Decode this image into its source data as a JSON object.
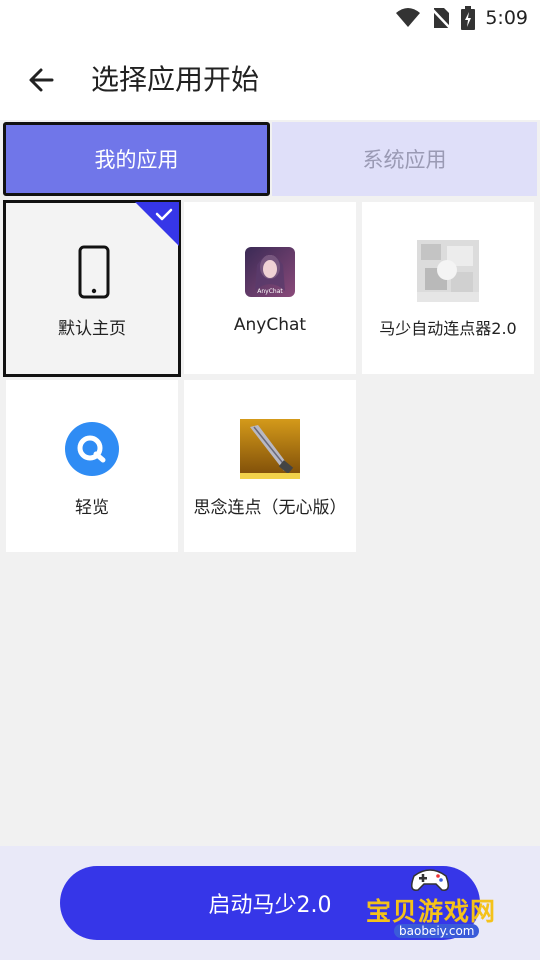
{
  "status": {
    "time": "5:09",
    "icons": [
      "wifi-icon",
      "no-sim-icon",
      "battery-icon"
    ]
  },
  "header": {
    "title": "选择应用开始",
    "back_icon": "arrow-left-icon"
  },
  "tabs": [
    {
      "label": "我的应用",
      "active": true
    },
    {
      "label": "系统应用",
      "active": false
    }
  ],
  "apps": [
    {
      "label": "默认主页",
      "icon": "phone-icon",
      "selected": true
    },
    {
      "label": "AnyChat",
      "icon": "anychat-app-icon",
      "selected": false
    },
    {
      "label": "马少自动连点器2.0",
      "icon": "masha-app-icon",
      "selected": false
    },
    {
      "label": "轻览",
      "icon": "qinglan-app-icon",
      "selected": false
    },
    {
      "label": "思念连点（无心版）",
      "icon": "sinian-app-icon",
      "selected": false
    }
  ],
  "bottom": {
    "start_label": "启动马少2.0"
  },
  "watermark": {
    "text": "宝贝游戏网",
    "url": "baobeiy.com"
  },
  "colors": {
    "accent": "#3636e8",
    "tab_active": "#7076e9",
    "tab_inactive": "#dfdff9"
  }
}
